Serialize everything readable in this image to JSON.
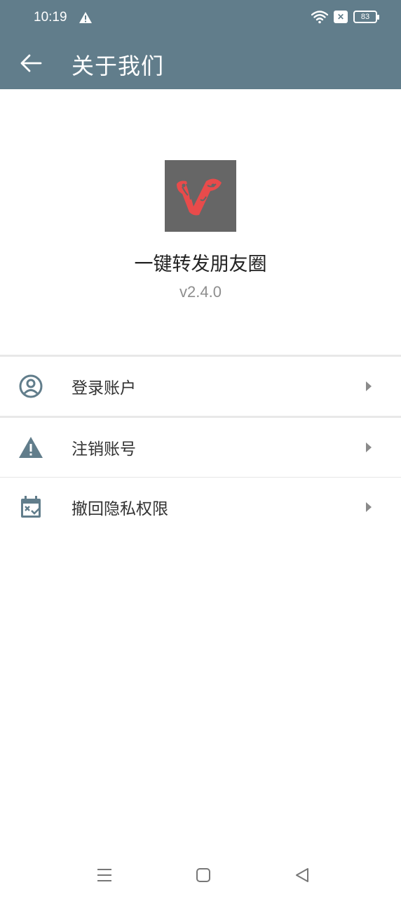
{
  "status_bar": {
    "time": "10:19",
    "battery": "83"
  },
  "app_bar": {
    "title": "关于我们"
  },
  "app_info": {
    "name": "一键转发朋友圈",
    "version": "v2.4.0"
  },
  "menu": {
    "items": [
      {
        "label": "登录账户",
        "icon": "account-circle-icon"
      },
      {
        "label": "注销账号",
        "icon": "warning-icon"
      },
      {
        "label": "撤回隐私权限",
        "icon": "calendar-remove-icon"
      }
    ]
  },
  "colors": {
    "primary": "#617d8b",
    "logo_bg": "#666666",
    "logo_mark": "#e84b4b"
  }
}
